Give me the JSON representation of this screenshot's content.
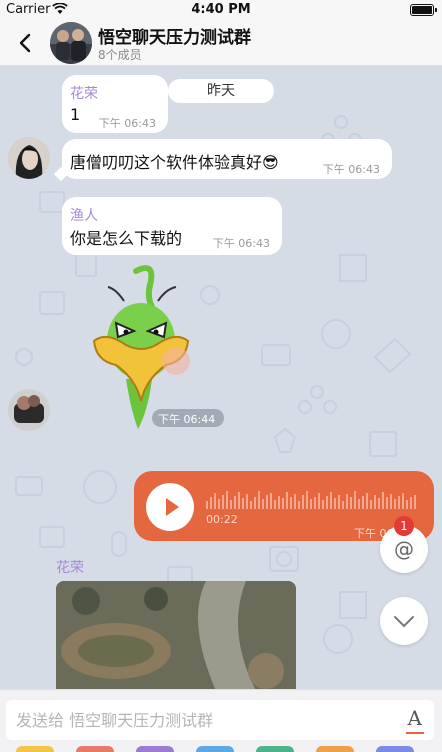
{
  "status_bar": {
    "carrier": "Carrier",
    "time": "4:40 PM"
  },
  "header": {
    "title": "悟空聊天压力测试群",
    "member_count": "8个成员",
    "back_icon": "chevron-left-icon"
  },
  "date_separator": "昨天",
  "messages": [
    {
      "sender": "花荣",
      "text": "1",
      "time": "下午 06:43"
    },
    {
      "sender": "",
      "text": "唐僧叨叨这个软件体验真好😎",
      "time": "下午 06:43"
    },
    {
      "sender": "渔人",
      "text": "你是怎么下载的",
      "time": "下午 06:43"
    },
    {
      "sender": "",
      "type": "sticker",
      "sticker_icon": "angry-duck-sticker",
      "time": "下午 06:44"
    },
    {
      "sender": "",
      "type": "voice",
      "duration": "00:22",
      "time": "下午 06:44",
      "color": "#e4673f"
    },
    {
      "sender": "花荣",
      "type": "image",
      "image_icon": "aerial-park-photo"
    }
  ],
  "floating": {
    "mention_label": "@",
    "mention_count": "1",
    "scroll_down_icon": "chevron-down-icon"
  },
  "input": {
    "placeholder": "发送给 悟空聊天压力测试群",
    "font_button_label": "A"
  },
  "colors": {
    "accent": "#e4673f",
    "sender_name": "#a58ad6",
    "chat_bg": "#d5dce6"
  }
}
